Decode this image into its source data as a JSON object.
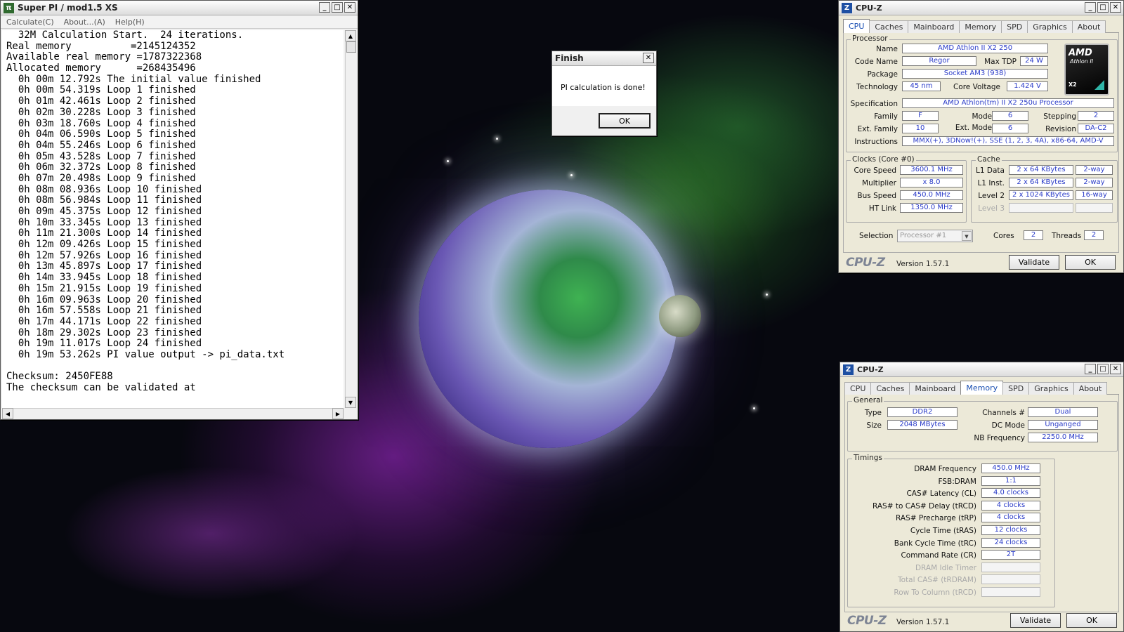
{
  "superpi": {
    "title": "Super PI / mod1.5 XS",
    "menu": [
      "Calculate(C)",
      "About...(A)",
      "Help(H)"
    ],
    "lines": [
      "  32M Calculation Start.  24 iterations.",
      "Real memory          =2145124352",
      "Available real memory =1787322368",
      "Allocated memory      =268435496",
      "  0h 00m 12.792s The initial value finished",
      "  0h 00m 54.319s Loop 1 finished",
      "  0h 01m 42.461s Loop 2 finished",
      "  0h 02m 30.228s Loop 3 finished",
      "  0h 03m 18.760s Loop 4 finished",
      "  0h 04m 06.590s Loop 5 finished",
      "  0h 04m 55.246s Loop 6 finished",
      "  0h 05m 43.528s Loop 7 finished",
      "  0h 06m 32.372s Loop 8 finished",
      "  0h 07m 20.498s Loop 9 finished",
      "  0h 08m 08.936s Loop 10 finished",
      "  0h 08m 56.984s Loop 11 finished",
      "  0h 09m 45.375s Loop 12 finished",
      "  0h 10m 33.345s Loop 13 finished",
      "  0h 11m 21.300s Loop 14 finished",
      "  0h 12m 09.426s Loop 15 finished",
      "  0h 12m 57.926s Loop 16 finished",
      "  0h 13m 45.897s Loop 17 finished",
      "  0h 14m 33.945s Loop 18 finished",
      "  0h 15m 21.915s Loop 19 finished",
      "  0h 16m 09.963s Loop 20 finished",
      "  0h 16m 57.558s Loop 21 finished",
      "  0h 17m 44.171s Loop 22 finished",
      "  0h 18m 29.302s Loop 23 finished",
      "  0h 19m 11.017s Loop 24 finished",
      "  0h 19m 53.262s PI value output -> pi_data.txt",
      "",
      "Checksum: 2450FE88",
      "The checksum can be validated at"
    ]
  },
  "finish": {
    "title": "Finish",
    "message": "PI calculation is done!",
    "ok": "OK"
  },
  "tabs": [
    "CPU",
    "Caches",
    "Mainboard",
    "Memory",
    "SPD",
    "Graphics",
    "About"
  ],
  "cpuz1": {
    "title": "CPU-Z",
    "processor_label": "Processor",
    "name_label": "Name",
    "name": "AMD Athlon II X2 250",
    "codename_label": "Code Name",
    "codename": "Regor",
    "maxtdp_label": "Max TDP",
    "maxtdp": "24 W",
    "package_label": "Package",
    "package": "Socket AM3 (938)",
    "technology_label": "Technology",
    "technology": "45 nm",
    "corevoltage_label": "Core Voltage",
    "corevoltage": "1.424 V",
    "spec_label": "Specification",
    "spec": "AMD Athlon(tm) II X2 250u Processor",
    "family_label": "Family",
    "family": "F",
    "model_label": "Model",
    "model": "6",
    "stepping_label": "Stepping",
    "stepping": "2",
    "extfamily_label": "Ext. Family",
    "extfamily": "10",
    "extmodel_label": "Ext. Model",
    "extmodel": "6",
    "revision_label": "Revision",
    "revision": "DA-C2",
    "instructions_label": "Instructions",
    "instructions": "MMX(+), 3DNow!(+), SSE (1, 2, 3, 4A), x86-64, AMD-V",
    "clocks_label": "Clocks (Core #0)",
    "corespeed_label": "Core Speed",
    "corespeed": "3600.1 MHz",
    "multiplier_label": "Multiplier",
    "multiplier": "x 8.0",
    "busspeed_label": "Bus Speed",
    "busspeed": "450.0 MHz",
    "htlink_label": "HT Link",
    "htlink": "1350.0 MHz",
    "cache_label": "Cache",
    "l1data_label": "L1 Data",
    "l1data": "2 x 64 KBytes",
    "l1data_way": "2-way",
    "l1inst_label": "L1 Inst.",
    "l1inst": "2 x 64 KBytes",
    "l1inst_way": "2-way",
    "level2_label": "Level 2",
    "level2": "2 x 1024 KBytes",
    "level2_way": "16-way",
    "level3_label": "Level 3",
    "selection_label": "Selection",
    "selection": "Processor #1",
    "cores_label": "Cores",
    "cores": "2",
    "threads_label": "Threads",
    "threads": "2",
    "logo_text": "CPU-Z",
    "version": "Version 1.57.1",
    "validate": "Validate",
    "ok": "OK",
    "amd_brand": "AMD",
    "amd_line": "Athlon II",
    "amd_model": "X2"
  },
  "cpuz2": {
    "title": "CPU-Z",
    "general_label": "General",
    "type_label": "Type",
    "type": "DDR2",
    "size_label": "Size",
    "size": "2048 MBytes",
    "channels_label": "Channels #",
    "channels": "Dual",
    "dcmode_label": "DC Mode",
    "dcmode": "Unganged",
    "nbfreq_label": "NB Frequency",
    "nbfreq": "2250.0 MHz",
    "timings_label": "Timings",
    "timings": [
      {
        "label": "DRAM Frequency",
        "value": "450.0 MHz"
      },
      {
        "label": "FSB:DRAM",
        "value": "1:1"
      },
      {
        "label": "CAS# Latency (CL)",
        "value": "4.0 clocks"
      },
      {
        "label": "RAS# to CAS# Delay (tRCD)",
        "value": "4 clocks"
      },
      {
        "label": "RAS# Precharge (tRP)",
        "value": "4 clocks"
      },
      {
        "label": "Cycle Time (tRAS)",
        "value": "12 clocks"
      },
      {
        "label": "Bank Cycle Time (tRC)",
        "value": "24 clocks"
      },
      {
        "label": "Command Rate (CR)",
        "value": "2T"
      },
      {
        "label": "DRAM Idle Timer",
        "value": ""
      },
      {
        "label": "Total CAS# (tRDRAM)",
        "value": ""
      },
      {
        "label": "Row To Column (tRCD)",
        "value": ""
      }
    ],
    "logo_text": "CPU-Z",
    "version": "Version 1.57.1",
    "validate": "Validate",
    "ok": "OK"
  },
  "icons": {
    "minimize": "minimize-icon",
    "maximize": "maximize-icon",
    "close": "close-icon"
  }
}
